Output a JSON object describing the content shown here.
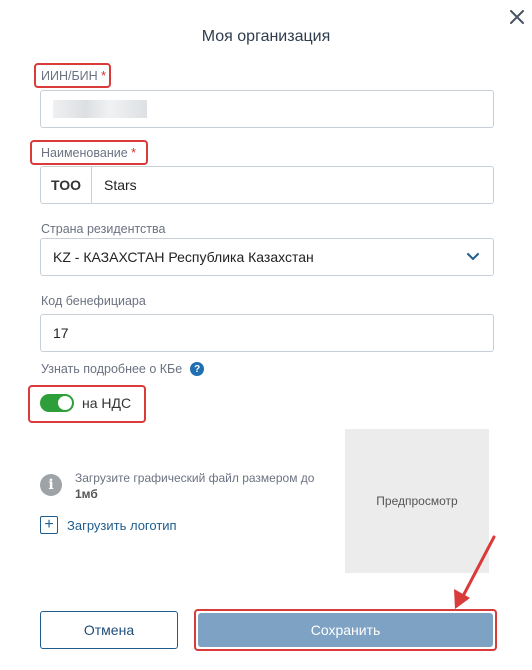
{
  "dialog": {
    "title": "Моя организация",
    "close_icon": "close-icon"
  },
  "fields": {
    "iin": {
      "label": "ИИН/БИН",
      "required_mark": "*"
    },
    "name": {
      "label": "Наименование",
      "required_mark": "*",
      "prefix": "ТОО",
      "value": "Stars"
    },
    "country": {
      "label": "Страна резидентства",
      "value": "KZ - КАЗАХСТАН Республика Казахстан"
    },
    "kbe": {
      "label": "Код бенефициара",
      "value": "17"
    }
  },
  "kbe_help": {
    "text": "Узнать подробнее о КБе",
    "icon": "?"
  },
  "vat_toggle": {
    "label": "на НДС",
    "on": true
  },
  "logo": {
    "info_text": "Загрузите графический файл размером до",
    "info_size": "1мб",
    "upload_label": "Загрузить логотип",
    "preview_label": "Предпросмотр"
  },
  "actions": {
    "cancel": "Отмена",
    "save": "Сохранить"
  },
  "colors": {
    "accent": "#1f5d8f",
    "highlight": "#d93a3a",
    "toggle_on": "#2e9e3b",
    "save_bg": "#7ea2c4"
  }
}
